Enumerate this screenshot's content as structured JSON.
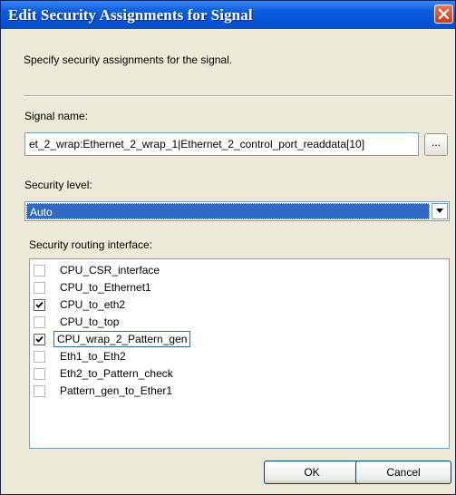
{
  "window": {
    "title": "Edit Security Assignments for Signal"
  },
  "description": "Specify security assignments for the signal.",
  "signal": {
    "label": "Signal name:",
    "value": "et_2_wrap:Ethernet_2_wrap_1|Ethernet_2_control_port_readdata[10]",
    "browse_label": "..."
  },
  "security_level": {
    "label": "Security level:",
    "selected": "Auto"
  },
  "routing": {
    "label": "Security routing interface:",
    "items": [
      {
        "label": "CPU_CSR_interface",
        "checked": false
      },
      {
        "label": "CPU_to_Ethernet1",
        "checked": false
      },
      {
        "label": "CPU_to_eth2",
        "checked": true
      },
      {
        "label": "CPU_to_top",
        "checked": false
      },
      {
        "label": "CPU_wrap_2_Pattern_gen",
        "checked": true,
        "focused": true
      },
      {
        "label": "Eth1_to_Eth2",
        "checked": false
      },
      {
        "label": "Eth2_to_Pattern_check",
        "checked": false
      },
      {
        "label": "Pattern_gen_to_Ether1",
        "checked": false
      }
    ]
  },
  "buttons": {
    "ok": "OK",
    "cancel": "Cancel"
  },
  "colors": {
    "titlebar": "#0553d6",
    "dialog_bg": "#ece9d8",
    "selection": "#316ac5",
    "close_button": "#c93c1e"
  }
}
